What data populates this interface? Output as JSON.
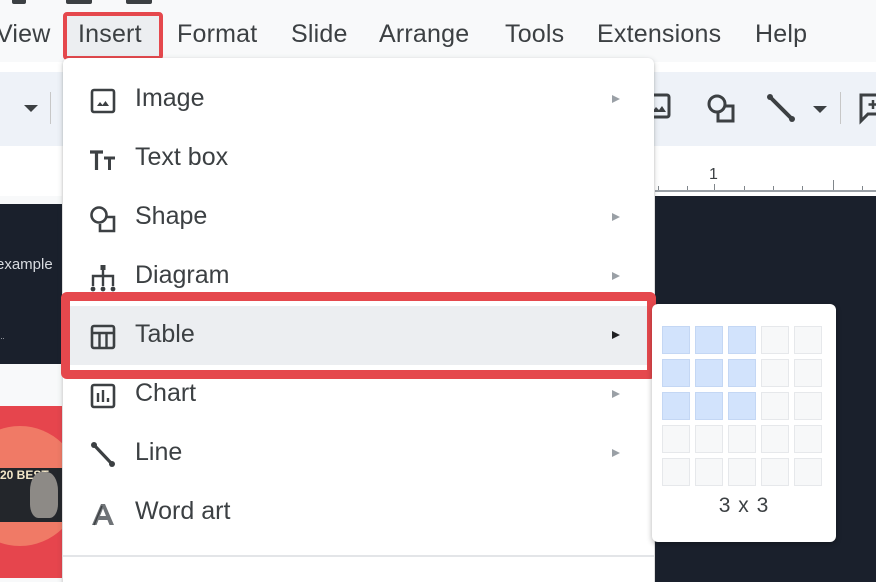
{
  "menubar": {
    "items": [
      {
        "label": "View"
      },
      {
        "label": "Insert",
        "active": true
      },
      {
        "label": "Format"
      },
      {
        "label": "Slide"
      },
      {
        "label": "Arrange"
      },
      {
        "label": "Tools"
      },
      {
        "label": "Extensions"
      },
      {
        "label": "Help"
      }
    ]
  },
  "toolbar": {
    "icons": [
      "dropdown-caret",
      "image-icon",
      "shape-icon",
      "line-icon",
      "line-dropdown-caret",
      "comment-icon"
    ]
  },
  "ruler": {
    "label": "1"
  },
  "filmstrip": {
    "slide1_text": "example",
    "slide1_small": "...",
    "slide2_text": "20 BEST"
  },
  "insert_menu": {
    "items": [
      {
        "label": "Image",
        "icon": "image-icon",
        "has_submenu": true
      },
      {
        "label": "Text box",
        "icon": "text-box-icon",
        "has_submenu": false
      },
      {
        "label": "Shape",
        "icon": "shape-icon",
        "has_submenu": true
      },
      {
        "label": "Diagram",
        "icon": "diagram-icon",
        "has_submenu": true
      },
      {
        "label": "Table",
        "icon": "table-icon",
        "has_submenu": true,
        "highlighted": true
      },
      {
        "label": "Chart",
        "icon": "chart-icon",
        "has_submenu": true
      },
      {
        "label": "Line",
        "icon": "line-icon",
        "has_submenu": true
      },
      {
        "label": "Word art",
        "icon": "word-art-icon",
        "has_submenu": false
      }
    ]
  },
  "table_picker": {
    "rows": 5,
    "cols": 5,
    "selected_rows": 3,
    "selected_cols": 3,
    "label": "3 x 3"
  },
  "colors": {
    "highlight_border": "#e5484d",
    "selected_cell": "#d2e3fc",
    "canvas_bg": "#1a202c"
  }
}
